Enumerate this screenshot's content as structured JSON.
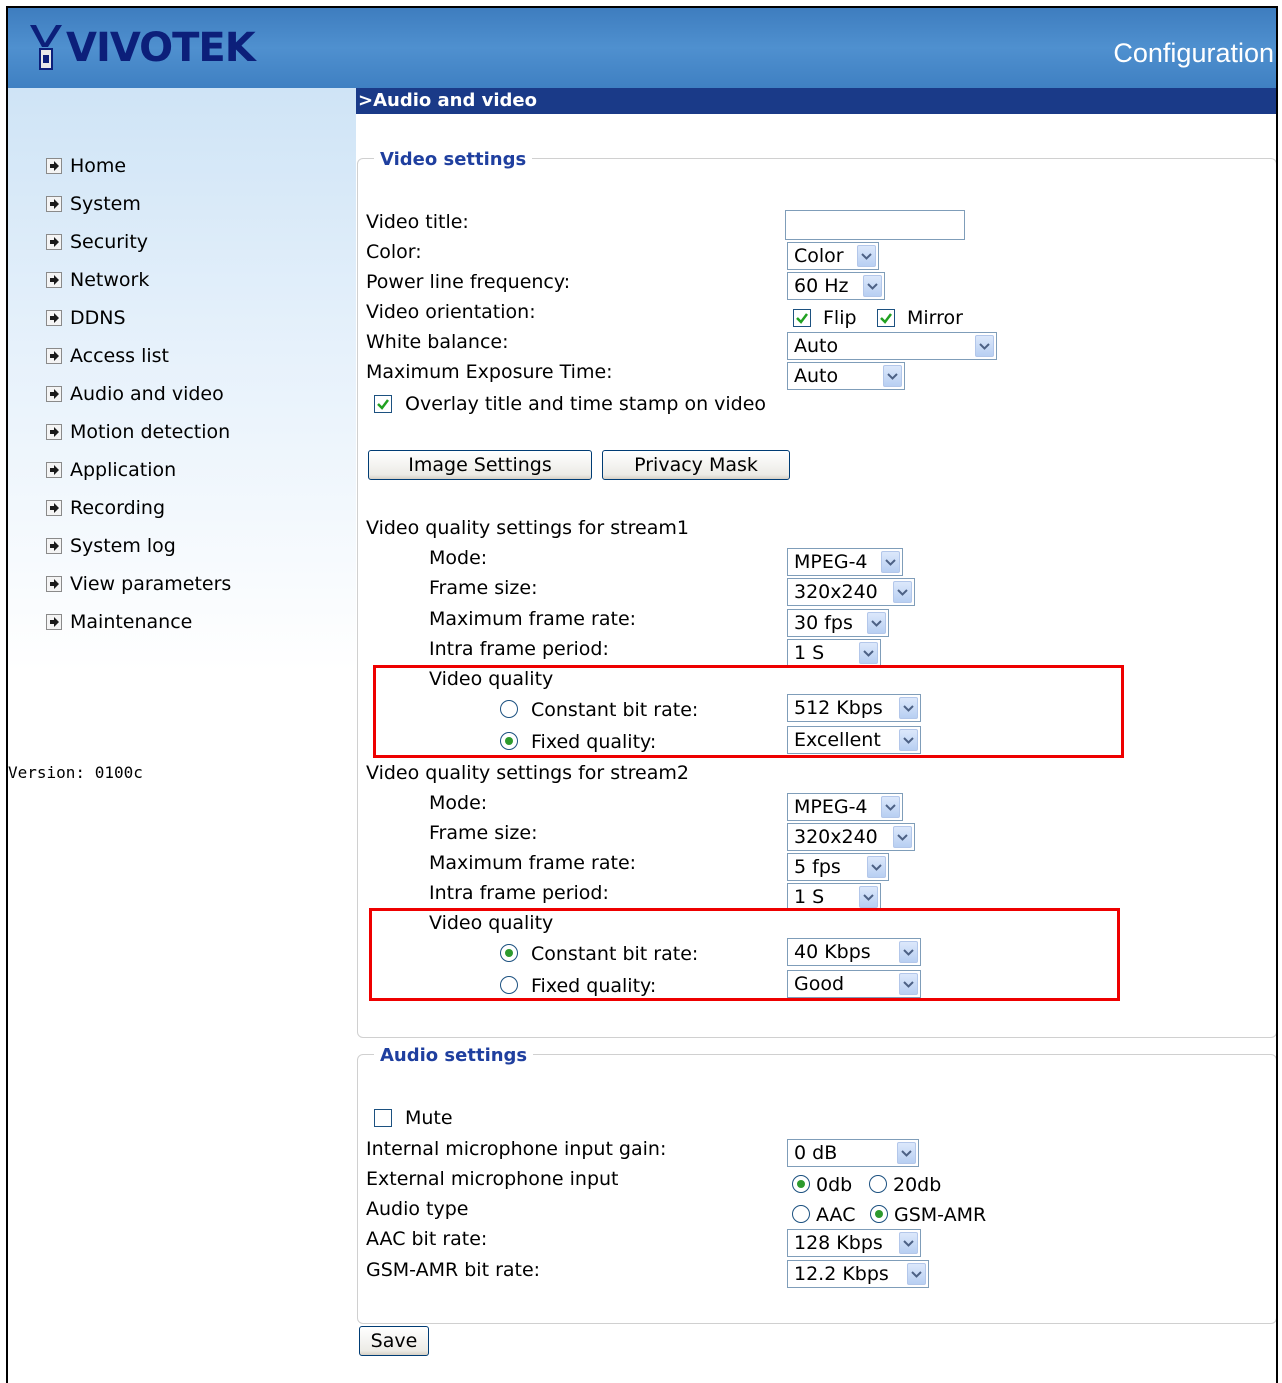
{
  "header": {
    "logo_text": "VIVOTEK",
    "title": "Configuration"
  },
  "sidebar": {
    "items": [
      {
        "label": "Home"
      },
      {
        "label": "System"
      },
      {
        "label": "Security"
      },
      {
        "label": "Network"
      },
      {
        "label": "DDNS"
      },
      {
        "label": "Access list"
      },
      {
        "label": "Audio and video"
      },
      {
        "label": "Motion detection"
      },
      {
        "label": "Application"
      },
      {
        "label": "Recording"
      },
      {
        "label": "System log"
      },
      {
        "label": "View parameters"
      },
      {
        "label": "Maintenance"
      }
    ],
    "version": "Version: 0100c"
  },
  "section_title": ">Audio and video",
  "video": {
    "legend": "Video settings",
    "title_label": "Video title:",
    "title_value": "",
    "color_label": "Color:",
    "color_value": "Color",
    "power_label": "Power line frequency:",
    "power_value": "60 Hz",
    "orientation_label": "Video orientation:",
    "flip_label": "Flip",
    "flip_checked": true,
    "mirror_label": "Mirror",
    "mirror_checked": true,
    "wb_label": "White balance:",
    "wb_value": "Auto",
    "exposure_label": "Maximum Exposure Time:",
    "exposure_value": "Auto",
    "overlay_label": "Overlay title and time stamp on video",
    "overlay_checked": true,
    "image_settings_button": "Image Settings",
    "privacy_mask_button": "Privacy Mask",
    "stream1": {
      "heading": "Video quality settings for stream1",
      "mode_label": "Mode:",
      "mode_value": "MPEG-4",
      "size_label": "Frame size:",
      "size_value": "320x240",
      "rate_label": "Maximum frame rate:",
      "rate_value": "30 fps",
      "intra_label": "Intra frame period:",
      "intra_value": "1 S",
      "quality_label": "Video quality",
      "cbr_label": "Constant bit rate:",
      "cbr_value": "512 Kbps",
      "cbr_selected": false,
      "fixed_label": "Fixed quality:",
      "fixed_value": "Excellent",
      "fixed_selected": true
    },
    "stream2": {
      "heading": "Video quality settings for stream2",
      "mode_label": "Mode:",
      "mode_value": "MPEG-4",
      "size_label": "Frame size:",
      "size_value": "320x240",
      "rate_label": "Maximum frame rate:",
      "rate_value": "5 fps",
      "intra_label": "Intra frame period:",
      "intra_value": "1 S",
      "quality_label": "Video quality",
      "cbr_label": "Constant bit rate:",
      "cbr_value": "40 Kbps",
      "cbr_selected": true,
      "fixed_label": "Fixed quality:",
      "fixed_value": "Good",
      "fixed_selected": false
    }
  },
  "audio": {
    "legend": "Audio settings",
    "mute_label": "Mute",
    "mute_checked": false,
    "gain_label": "Internal microphone input gain:",
    "gain_value": "0 dB",
    "ext_label": "External microphone input",
    "ext_opt1": "0db",
    "ext_opt2": "20db",
    "type_label": "Audio type",
    "type_opt1": "AAC",
    "type_opt2": "GSM-AMR",
    "aac_label": "AAC bit rate:",
    "aac_value": "128 Kbps",
    "gsm_label": "GSM-AMR bit rate:",
    "gsm_value": "12.2 Kbps"
  },
  "save_button": "Save",
  "colors": {
    "header_blue": "#4f90cf",
    "section_bar": "#1a3a88",
    "legend_blue": "#1f3f9f",
    "highlight_red": "#ee0000",
    "radio_green": "#2d9a2d"
  }
}
